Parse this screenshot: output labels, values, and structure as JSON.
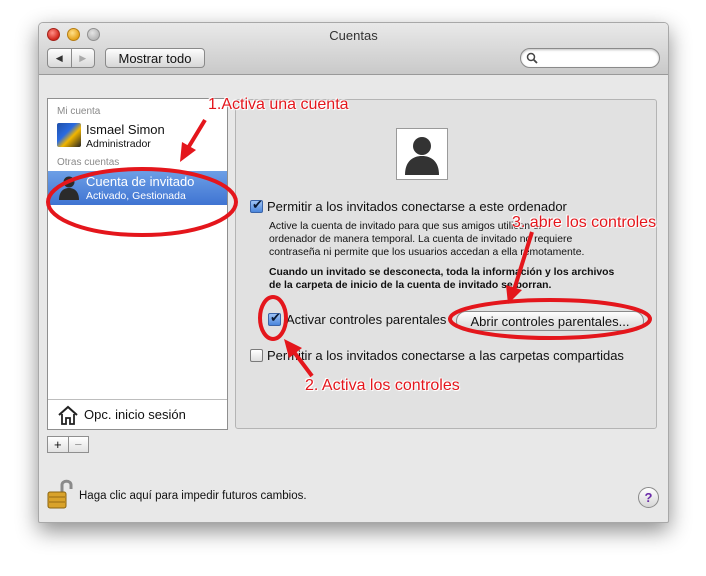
{
  "window": {
    "title": "Cuentas",
    "show_all_label": "Mostrar todo",
    "nav_back": "◀",
    "nav_forward": "▶",
    "search": {
      "placeholder": ""
    }
  },
  "sidebar": {
    "my_account_header": "Mi cuenta",
    "my_account": {
      "name": "Ismael Simon",
      "role": "Administrador"
    },
    "other_accounts_header": "Otras cuentas",
    "guest_account": {
      "name": "Cuenta de invitado",
      "status": "Activado, Gestionada"
    },
    "login_options_label": "Opc. inicio sesión",
    "add_label": "+",
    "remove_label": "−"
  },
  "content": {
    "allow_guests": {
      "label": "Permitir a los invitados conectarse a este ordenador",
      "checked": true
    },
    "description_lines": [
      "Active la cuenta de invitado para que sus amigos utilicen el",
      "ordenador de manera temporal. La cuenta de invitado no requiere",
      "contraseña ni permite que los usuarios accedan a ella remotamente."
    ],
    "warning_lines": [
      "Cuando un invitado se desconecta, toda la información y los archivos",
      "de la carpeta de inicio de la cuenta de invitado se borran."
    ],
    "parental_controls": {
      "label": "Activar controles parentales",
      "checked": true
    },
    "open_parental_button": "Abrir controles parentales...",
    "shared_folders": {
      "label": "Permitir a los invitados conectarse a las carpetas compartidas",
      "checked": false
    }
  },
  "footer": {
    "lock_label": "Haga clic aquí para impedir futuros cambios.",
    "help_label": "?"
  },
  "annotations": {
    "step1": "1.Activa una cuenta",
    "step2": "2. Activa los controles",
    "step3": "3. abre los controles",
    "color": "#e4161c"
  }
}
